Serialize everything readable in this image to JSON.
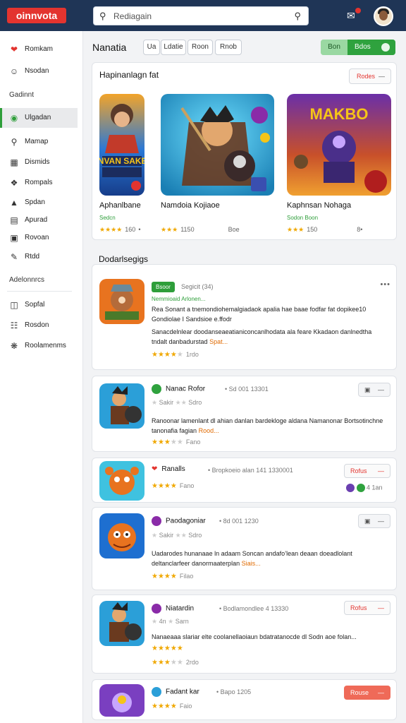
{
  "app": {
    "logo": "oinnvota"
  },
  "search": {
    "placeholder": "Rediagain"
  },
  "sidebar": {
    "items_top": [
      {
        "icon": "heart-icon",
        "label": "Romkam"
      },
      {
        "icon": "user-icon",
        "label": "Nsodan"
      }
    ],
    "heading_1": "Gadinnt",
    "items_mid": [
      {
        "icon": "chat-icon",
        "label": "Ulgadan",
        "active": true
      },
      {
        "icon": "search-icon",
        "label": "Mamap"
      },
      {
        "icon": "grid-icon",
        "label": "Dismids"
      },
      {
        "icon": "tag-icon",
        "label": "Rompals"
      },
      {
        "icon": "chart-icon",
        "label": "Spdan"
      },
      {
        "icon": "inbox-icon",
        "label": "Apurad"
      },
      {
        "icon": "bag-icon",
        "label": "Rovoan"
      },
      {
        "icon": "note-icon",
        "label": "Rtdd"
      }
    ],
    "heading_2": "Adelonnrcs",
    "items_bottom": [
      {
        "icon": "box-icon",
        "label": "Sopfal"
      },
      {
        "icon": "calendar-icon",
        "label": "Rosdon"
      },
      {
        "icon": "settings-icon",
        "label": "Roolamenms"
      }
    ]
  },
  "main": {
    "title": "Nanatia",
    "filters": [
      "Ua",
      "Ldatie",
      "Roon",
      "Rnob"
    ],
    "toggle": {
      "left": "Bon",
      "right": "Bdos"
    },
    "featured": {
      "heading": "Hapinanlagn fat",
      "button": "Rodes",
      "cards": [
        {
          "name": "Aphanlbane",
          "sub": "Sedcn",
          "rating": "160",
          "rating_suffix": "•",
          "art_text": "MNVAN SAKER"
        },
        {
          "name": "Namdoia Kojiaoe",
          "sub": "",
          "rating": "1150",
          "rating_suffix": "Boe"
        },
        {
          "name": "Kaphnsan Nohaga",
          "sub": "Sodon Boon",
          "rating": "150",
          "rating_suffix": "8•",
          "art_text": "MAKBO"
        }
      ]
    },
    "section_title": "Dodarlsegigs",
    "reviews": [
      {
        "tag": "Bsoor",
        "meta": "Segicit (34)",
        "small": "Nemmioaid Arlonen...",
        "text": "Rea Sonant a tnemondiohemalgiadaok apalia hae baae fodfar fat dopikee10 Gondiolae I Sandsioe e.ffodr",
        "text2": "Sanacdelnlear doodanseaeatianiconcanlhodata ala feare Kkadaon danlnedtha tndalt danbadurstad",
        "more": "Spat...",
        "stars": "★★★★★",
        "count": "1rdo"
      },
      {
        "title": "Nanac Rofor",
        "meta": "• Sd 001 13301",
        "sub": "Sakir",
        "sub2": "Sdro",
        "text": "Ranoonar lamenlant dl ahian danlan bardekloge aldana Namanonar Bortsotinchne tanonafia fagian",
        "more": "Rood...",
        "stars": "★★★★★",
        "count": "Fano"
      },
      {
        "title": "Ranalls",
        "meta": "• Bropkoeio alan 141 1330001",
        "stars": "★★★★★",
        "count": "Fano",
        "side": "4 1an",
        "button": "Rofus"
      },
      {
        "title": "Paodagoniar",
        "meta": "• 8d 001 1230",
        "sub": "Sakir",
        "sub2": "Sdro",
        "text": "Uadarodes hunanaae ln adaam Soncan andafo’lean deaan doeadlolant deltanclarfeer danormaaterplan",
        "more": "Siais...",
        "stars": "★★★★★",
        "count": "Filao"
      },
      {
        "title": "Niatardin",
        "meta": "• Bodlamondlee 4 13330",
        "sub": "4n",
        "sub2": "Sarn",
        "text": "Nanaeaaa slariar elte coolanellaoiaun bdatratanocde dl Sodn aoe folan...",
        "count": "2rdo",
        "button": "Rofus"
      },
      {
        "title": "Fadant kar",
        "meta": "• Bapo 1205",
        "stars": "★★★★★",
        "count": "Faio",
        "button": "Rouse"
      }
    ]
  }
}
